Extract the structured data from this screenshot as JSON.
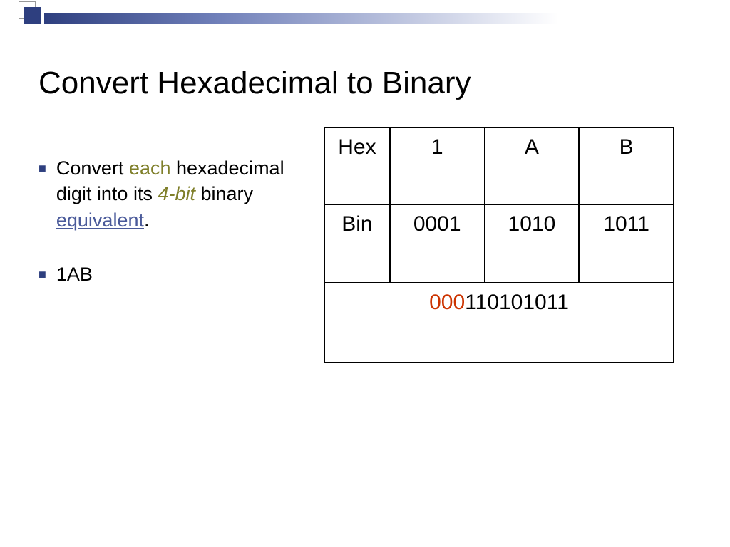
{
  "title": "Convert Hexadecimal to Binary",
  "bullets": {
    "b1": {
      "p1": "Convert ",
      "each": "each",
      "p2": " hexadecimal digit into its ",
      "fourbit": "4-bit",
      "p3": " binary ",
      "equiv": "equivalent",
      "p4": "."
    },
    "b2": "1AB"
  },
  "table": {
    "hexLabel": "Hex",
    "binLabel": "Bin",
    "hex": [
      "1",
      "A",
      "B"
    ],
    "bin": [
      "0001",
      "1010",
      "1011"
    ],
    "result": {
      "prefix": "000",
      "rest": "110101011"
    }
  }
}
